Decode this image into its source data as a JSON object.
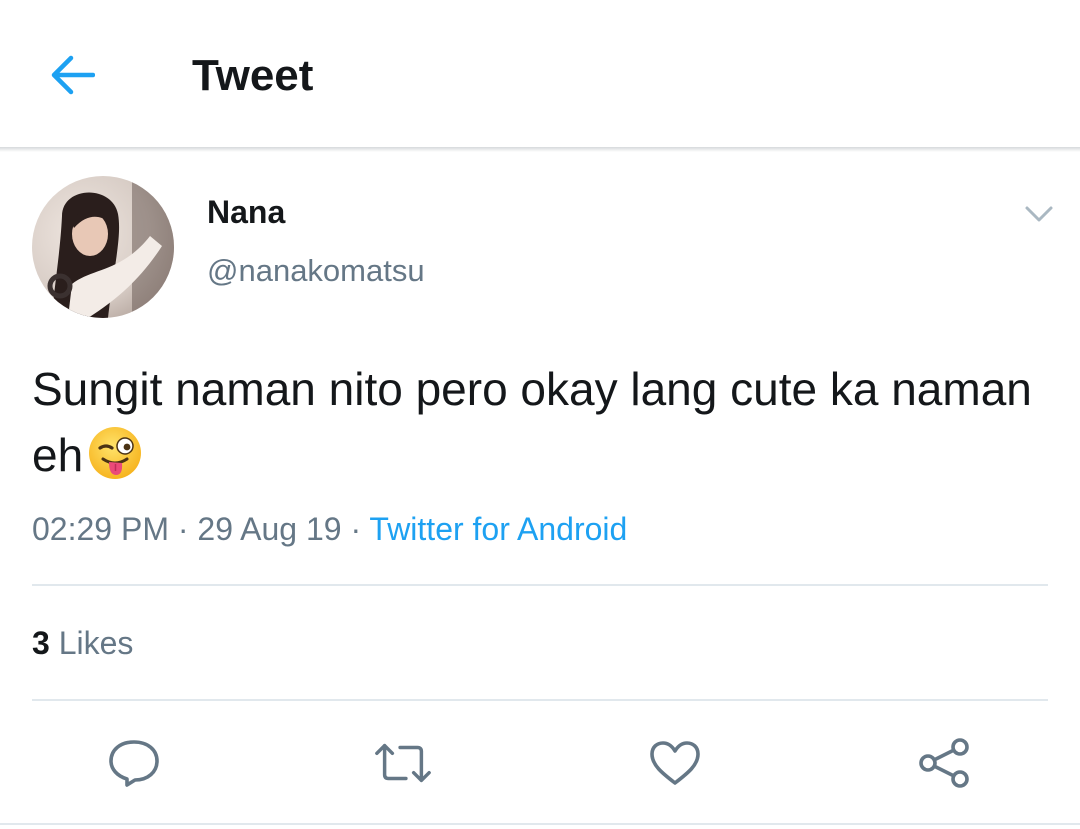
{
  "header": {
    "title": "Tweet",
    "back_icon": "arrow-left-icon",
    "accent_color": "#1da1f2"
  },
  "tweet": {
    "author_name": "Nana",
    "author_handle": "@nanakomatsu",
    "caret_icon": "chevron-down-icon",
    "text": "Sungit naman nito pero okay lang cute ka naman eh",
    "emoji": "winking-face-with-tongue",
    "time": "02:29 PM",
    "date": "29 Aug 19",
    "separator": "·",
    "source": "Twitter for Android",
    "likes_count": "3",
    "likes_label": "Likes"
  },
  "actions": [
    {
      "name": "reply",
      "icon": "reply-icon"
    },
    {
      "name": "retweet",
      "icon": "retweet-icon"
    },
    {
      "name": "like",
      "icon": "heart-icon"
    },
    {
      "name": "share",
      "icon": "share-icon"
    }
  ],
  "colors": {
    "text_primary": "#14171a",
    "text_secondary": "#657786",
    "link": "#1da1f2",
    "divider": "#e1e8ed"
  }
}
